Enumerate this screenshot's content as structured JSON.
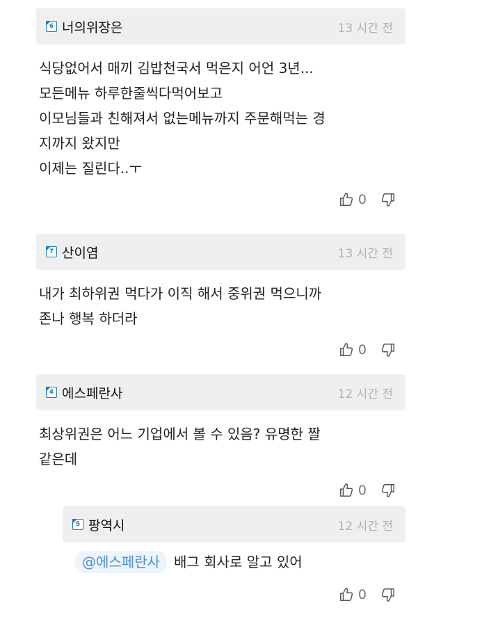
{
  "comments": [
    {
      "badge": "6",
      "user": "너의위장은",
      "time": "13 시간 전",
      "lines": [
        "식당없어서 매끼 김밥천국서 먹은지 어언 3년...",
        "모든메뉴 하루한줄씩다먹어보고",
        "이모님들과 친해져서 없는메뉴까지 주문해먹는 경",
        "지까지 왔지만",
        "이제는 질린다..ㅜ"
      ],
      "likes": "0"
    },
    {
      "badge": "7",
      "user": "산이염",
      "time": "13 시간 전",
      "lines": [
        "내가 최하위권 먹다가 이직 해서 중위권 먹으니까",
        "존나 행복 하더라"
      ],
      "likes": "0"
    },
    {
      "badge": "4",
      "user": "에스페란사",
      "time": "12 시간 전",
      "lines": [
        "최상위권은 어느 기업에서 볼 수 있음? 유명한 짤",
        "같은데"
      ],
      "likes": "0"
    },
    {
      "badge": "5",
      "user": "팡역시",
      "time": "12 시간 전",
      "mention": "@에스페란사",
      "lines": [
        "배그 회사로 알고 있어"
      ],
      "likes": "0"
    }
  ],
  "icons": {
    "like": "thumbs-up-icon",
    "dislike": "thumbs-down-icon",
    "level": "level-badge-icon"
  },
  "colors": {
    "header_bg": "#efefef",
    "badge": "#1e7fb0",
    "mention_text": "#4a8fd0",
    "mention_bg": "#eef4fb",
    "time": "#b0b0b0"
  }
}
